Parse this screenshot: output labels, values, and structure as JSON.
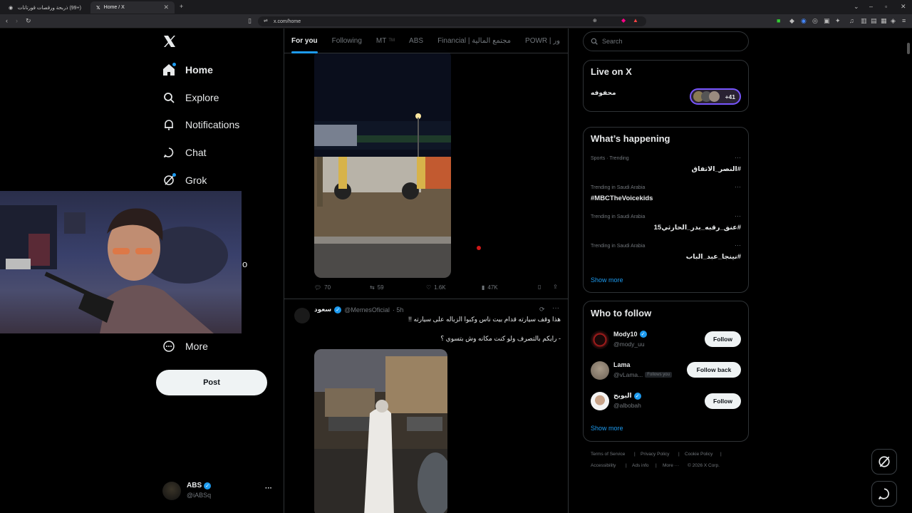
{
  "browser": {
    "tabs": [
      {
        "label": "(+99) ذربحة ورقصات قورتانات القديمة",
        "active": false
      },
      {
        "label": "Home / X",
        "active": true
      }
    ],
    "url": "x.com/home"
  },
  "sidebar": {
    "logo": "X",
    "items": [
      {
        "label": "Home",
        "icon": "home-icon",
        "active": true
      },
      {
        "label": "Explore",
        "icon": "search-icon"
      },
      {
        "label": "Notifications",
        "icon": "bell-icon"
      },
      {
        "label": "Chat",
        "icon": "chat-icon"
      },
      {
        "label": "Grok",
        "icon": "grok-icon"
      },
      {
        "label": "More",
        "icon": "more-circle-icon"
      }
    ],
    "partial_label": "o",
    "post_label": "Post",
    "account": {
      "name": "ABS",
      "handle": "@iABSq",
      "more": "···"
    }
  },
  "feed": {
    "tabs": [
      "For you",
      "Following",
      "MT",
      "ABS",
      "Financial | مجتمع المالية",
      "POWR | ور"
    ],
    "tab_badge": "TM",
    "active_tab": 0,
    "post1": {
      "replies": "70",
      "reposts": "59",
      "likes": "1.6K",
      "views": "47K"
    },
    "post2": {
      "author": "سعود",
      "handle": "@MemesOficial",
      "time": "· 5h",
      "line1": "هذا وقف سيارته قدام بيت ناس وكبوا الزباله على سيارته !!",
      "line2": "- رايكم بالتصرف ولو كنت مكانه وش بتسوي ؟"
    }
  },
  "right": {
    "search_placeholder": "Search",
    "live": {
      "title": "Live on X",
      "host": "محفوفه",
      "count": "+41"
    },
    "happening": {
      "title": "What’s happening",
      "trends": [
        {
          "meta": "Sports · Trending",
          "name": "#النصر_الاتفاق"
        },
        {
          "meta": "Trending in Saudi Arabia",
          "name": "#MBCTheVoicekids"
        },
        {
          "meta": "Trending in Saudi Arabia",
          "name": "#عنق_رقبه_بدر_الحارثي15"
        },
        {
          "meta": "Trending in Saudi Arabia",
          "name": "#نينجا_عبد_الباب"
        }
      ],
      "show_more": "Show more"
    },
    "who_to_follow": {
      "title": "Who to follow",
      "users": [
        {
          "name": "Mody10",
          "handle": "@mody_uu",
          "button": "Follow",
          "verified": true
        },
        {
          "name": "Lama",
          "handle": "@vLama...",
          "badge": "Follows you",
          "button": "Follow back",
          "verified": false
        },
        {
          "name": "البوبح",
          "handle": "@albobah",
          "button": "Follow",
          "verified": true
        }
      ],
      "show_more": "Show more"
    },
    "footer": {
      "links": [
        "Terms of Service",
        "Privacy Policy",
        "Cookie Policy",
        "Accessibility",
        "Ads info",
        "More ···"
      ],
      "copyright": "© 2026 X Corp."
    }
  },
  "colors": {
    "accent": "#1d9bf0",
    "bg": "#000000",
    "border": "#2f3336",
    "muted": "#71767b"
  }
}
